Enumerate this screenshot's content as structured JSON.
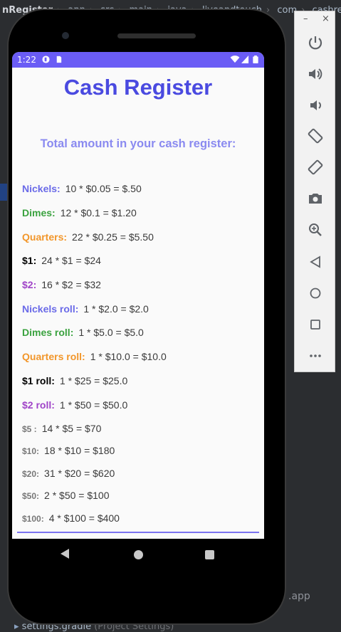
{
  "ide": {
    "breadcrumb": [
      "nRegister",
      "app",
      "src",
      "main",
      "java",
      "liveandtouch",
      "com",
      "cashregiste"
    ],
    "right_label": ".app",
    "bottom_file": "settings.gradle",
    "bottom_hint": "(Project Settings)"
  },
  "device": {
    "status": {
      "time": "1:22"
    },
    "app": {
      "title": "Cash Register",
      "subtitle": "Total amount in your cash register:",
      "rows": [
        {
          "label": "Nickels:",
          "value": "10 * $0.05 = $.50",
          "color": "#6a6ae8"
        },
        {
          "label": "Dimes:",
          "value": "12 * $0.1 = $1.20",
          "color": "#3aa23f"
        },
        {
          "label": "Quarters:",
          "value": "22 * $0.25 = $5.50",
          "color": "#f2962a"
        },
        {
          "label": "$1:",
          "value": "24 * $1 = $24",
          "color": "#000000"
        },
        {
          "label": "$2:",
          "value": "16 * $2 = $32",
          "color": "#a044c8"
        },
        {
          "label": "Nickels roll:",
          "value": "1 * $2.0 = $2.0",
          "color": "#6a6ae8"
        },
        {
          "label": "Dimes roll:",
          "value": "1 * $5.0 = $5.0",
          "color": "#3aa23f"
        },
        {
          "label": "Quarters roll:",
          "value": "1 * $10.0 = $10.0",
          "color": "#f2962a"
        },
        {
          "label": "$1 roll:",
          "value": "1 * $25 = $25.0",
          "color": "#000000"
        },
        {
          "label": "$2 roll:",
          "value": "1 * $50 = $50.0",
          "color": "#a044c8"
        },
        {
          "label": "$5 :",
          "value": "14 * $5 = $70",
          "color": "#777777"
        },
        {
          "label": "$10:",
          "value": "18 * $10 = $180",
          "color": "#777777"
        },
        {
          "label": "$20:",
          "value": "31 * $20 = $620",
          "color": "#777777"
        },
        {
          "label": "$50:",
          "value": "2 * $50 = $100",
          "color": "#777777"
        },
        {
          "label": "$100:",
          "value": "4 * $100 = $400",
          "color": "#777777"
        }
      ]
    },
    "nav": {
      "icons": [
        "back-icon",
        "home-icon",
        "recents-icon"
      ]
    }
  },
  "emulator_toolbar": {
    "window_controls": [
      "–",
      "×"
    ],
    "buttons": [
      "power-icon",
      "volume-up-icon",
      "volume-down-icon",
      "rotate-left-icon",
      "rotate-right-icon",
      "camera-icon",
      "zoom-icon",
      "back-icon",
      "home-icon",
      "overview-icon",
      "more-icon"
    ]
  },
  "colors": {
    "status_bar": "#6a5cf5",
    "title": "#4a4ae0",
    "subtitle": "#8a8af0",
    "accent_line": "#7b73f0"
  }
}
